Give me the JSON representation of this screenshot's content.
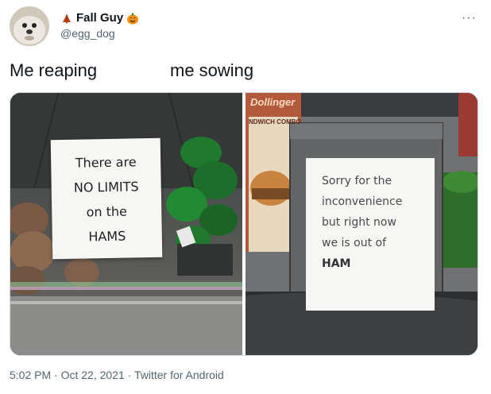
{
  "tweet": {
    "display_name": "Fall Guy",
    "handle": "@egg_dog",
    "more_label": "···",
    "caption_left": "Me reaping",
    "caption_right": "me sowing",
    "media": {
      "left_sign_lines": [
        "There are",
        "NO LIMITS",
        "on the",
        "HAMS"
      ],
      "right_sign_lines": [
        "Sorry for the",
        "inconvenience",
        "but right now",
        "we is out of",
        "HAM"
      ],
      "background_sign_top": "Dollinger",
      "background_sign_sub": "NDWICH COMBO"
    },
    "footer": {
      "time": "5:02 PM",
      "sep1": "·",
      "date": "Oct 22, 2021",
      "sep2": "·",
      "client": "Twitter for Android"
    }
  },
  "colors": {
    "text_primary": "#0f1419",
    "text_secondary": "#536471",
    "border": "#cfd9de",
    "accent_orange": "#f4900c"
  }
}
